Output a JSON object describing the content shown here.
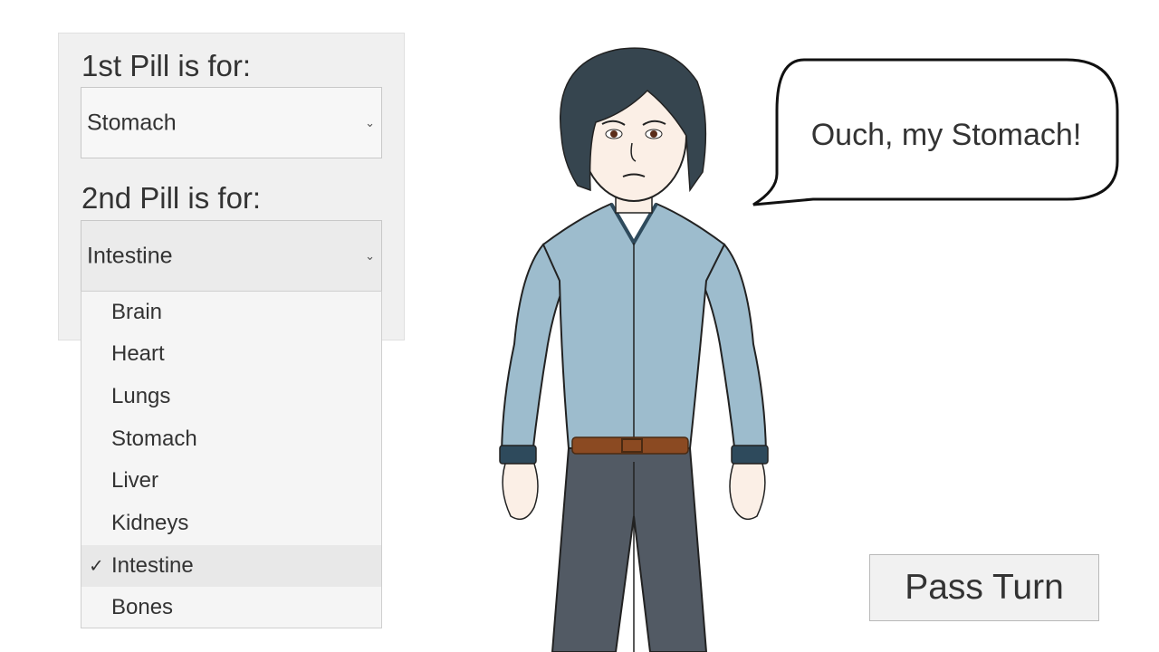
{
  "pill1": {
    "label": "1st Pill is for:",
    "value": "Stomach"
  },
  "pill2": {
    "label": "2nd Pill is for:",
    "value": "Intestine"
  },
  "dropdown": {
    "options": [
      "Brain",
      "Heart",
      "Lungs",
      "Stomach",
      "Liver",
      "Kidneys",
      "Intestine",
      "Bones"
    ],
    "selected_index": 6,
    "check_glyph": "✓"
  },
  "speech": {
    "text": "Ouch, my Stomach!"
  },
  "actions": {
    "pass_turn": "Pass Turn"
  },
  "icons": {
    "chevron": "⌄"
  },
  "colors": {
    "shirt": "#9dbccd",
    "pants": "#525a64",
    "hair": "#36454f",
    "belt": "#8b4a22",
    "skin": "#fbefe6"
  }
}
